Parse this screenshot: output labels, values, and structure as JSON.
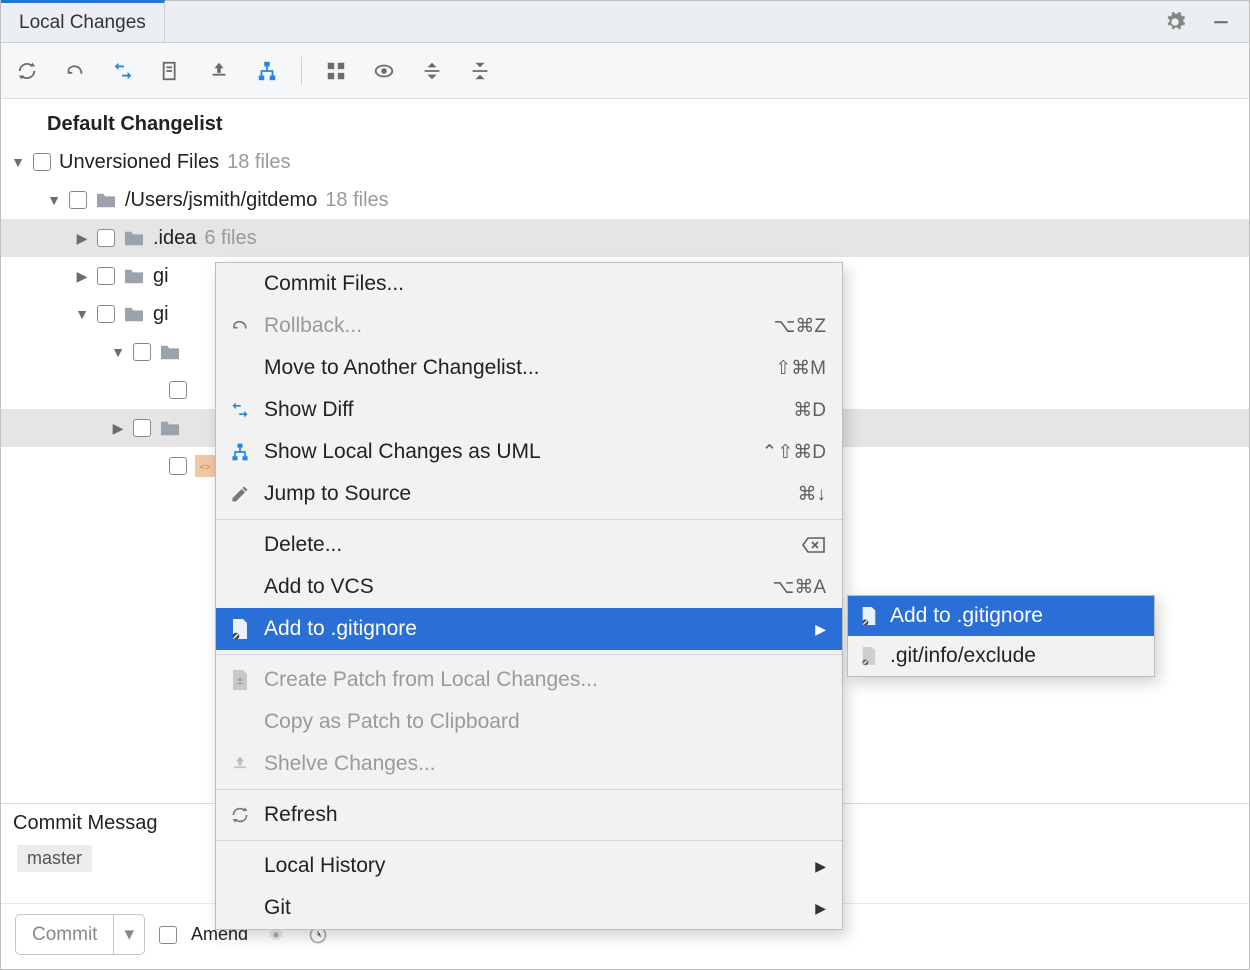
{
  "tab": {
    "title": "Local Changes"
  },
  "tree": {
    "changelist": "Default Changelist",
    "unversioned_label": "Unversioned Files",
    "unversioned_count": "18 files",
    "root_path": "/Users/jsmith/gitdemo",
    "root_count": "18 files",
    "idea_folder": ".idea",
    "idea_count": "6 files",
    "gi1": "gi",
    "gi2": "gi"
  },
  "contextmenu": {
    "commit_files": "Commit Files...",
    "rollback": "Rollback...",
    "rollback_sc": "⌥⌘Z",
    "move_changelist": "Move to Another Changelist...",
    "move_sc": "⇧⌘M",
    "show_diff": "Show Diff",
    "show_diff_sc": "⌘D",
    "show_uml": "Show Local Changes as UML",
    "show_uml_sc": "⌃⇧⌘D",
    "jump_source": "Jump to Source",
    "jump_source_sc": "⌘↓",
    "delete": "Delete...",
    "delete_sc": "⌦",
    "add_vcs": "Add to VCS",
    "add_vcs_sc": "⌥⌘A",
    "add_gitignore": "Add to .gitignore",
    "create_patch": "Create Patch from Local Changes...",
    "copy_patch": "Copy as Patch to Clipboard",
    "shelve": "Shelve Changes...",
    "refresh": "Refresh",
    "local_history": "Local History",
    "git": "Git"
  },
  "submenu": {
    "add_gitignore": "Add to .gitignore",
    "git_info_exclude": ".git/info/exclude"
  },
  "bottom": {
    "commit_message_label": "Commit Messag",
    "branch": "master",
    "commit_button": "Commit",
    "amend": "Amend"
  }
}
